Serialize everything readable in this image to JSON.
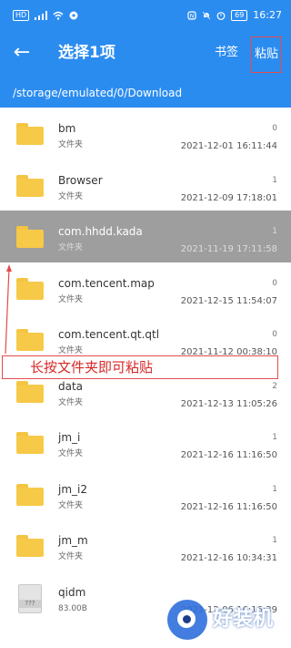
{
  "status_bar": {
    "hd": "HD",
    "battery": "69",
    "time": "16:27"
  },
  "app_bar": {
    "title": "选择1项",
    "bookmark": "书签",
    "paste": "粘贴"
  },
  "path": "/storage/emulated/0/Download",
  "files": [
    {
      "name": "bm",
      "sub": "文件夹",
      "count": "0",
      "date": "2021-12-01 16:11:44",
      "type": "folder",
      "selected": false
    },
    {
      "name": "Browser",
      "sub": "文件夹",
      "count": "1",
      "date": "2021-12-09 17:18:01",
      "type": "folder",
      "selected": false
    },
    {
      "name": "com.hhdd.kada",
      "sub": "文件夹",
      "count": "1",
      "date": "2021-11-19 17:11:58",
      "type": "folder",
      "selected": true
    },
    {
      "name": "com.tencent.map",
      "sub": "文件夹",
      "count": "0",
      "date": "2021-12-15 11:54:07",
      "type": "folder",
      "selected": false
    },
    {
      "name": "com.tencent.qt.qtl",
      "sub": "文件夹",
      "count": "0",
      "date": "2021-11-12 00:38:10",
      "type": "folder",
      "selected": false
    },
    {
      "name": "data",
      "sub": "文件夹",
      "count": "2",
      "date": "2021-12-13 11:05:26",
      "type": "folder",
      "selected": false
    },
    {
      "name": "jm_i",
      "sub": "文件夹",
      "count": "1",
      "date": "2021-12-16 11:16:50",
      "type": "folder",
      "selected": false
    },
    {
      "name": "jm_i2",
      "sub": "文件夹",
      "count": "1",
      "date": "2021-12-16 11:16:50",
      "type": "folder",
      "selected": false
    },
    {
      "name": "jm_m",
      "sub": "文件夹",
      "count": "1",
      "date": "2021-12-16 10:34:31",
      "type": "folder",
      "selected": false
    },
    {
      "name": "qidm",
      "sub": "83.00B",
      "count": "",
      "date": "2021-12-06 16:16:39",
      "type": "file",
      "file_label": "???",
      "selected": false
    }
  ],
  "annotation": "长按文件夹即可粘贴",
  "watermark": "好装机",
  "colors": {
    "accent": "#2b8cf0",
    "selected_row": "#9e9e9e",
    "annotation_red": "#d62828",
    "folder": "#f7c948"
  }
}
